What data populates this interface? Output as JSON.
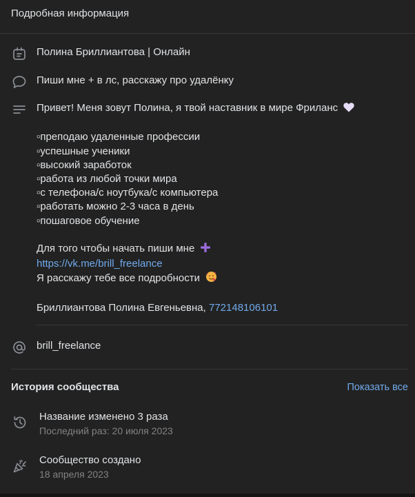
{
  "header": {
    "title": "Подробная информация"
  },
  "info": {
    "status_title": "Полина Бриллиантова | Онлайн",
    "status_message": "Пиши мне + в лс, расскажу про удалёнку",
    "description": {
      "intro": "Привет! Меня зовут Полина, я твой наставник в мире Фриланс",
      "bullets": [
        "▫преподаю удаленные профессии",
        "▫успешные ученики",
        "▫высокий заработок",
        "▫работа из любой точки мира",
        "▫с телефона/с ноутбука/с компьютера",
        "▫работать можно 2-3 часа в день",
        "▫пошаговое обучение"
      ],
      "cta": "Для того чтобы начать пиши мне",
      "link": "https://vk.me/brill_freelance",
      "details": "Я расскажу тебе все подробности",
      "owner": "Бриллиантова Полина Евгеньевна,",
      "inn": "772148106101"
    },
    "username": "brill_freelance"
  },
  "history": {
    "title": "История сообщества",
    "show_all": "Показать все",
    "items": [
      {
        "title": "Название изменено 3 раза",
        "subtitle": "Последний раз: 20 июля 2023",
        "icon": "history-icon"
      },
      {
        "title": "Сообщество создано",
        "subtitle": "18 апреля 2023",
        "icon": "party-popper-icon"
      }
    ]
  },
  "colors": {
    "background": "#222222",
    "text": "#e1e3e6",
    "link": "#71aaeb",
    "secondary": "#828282",
    "icon": "#8b8f95"
  }
}
